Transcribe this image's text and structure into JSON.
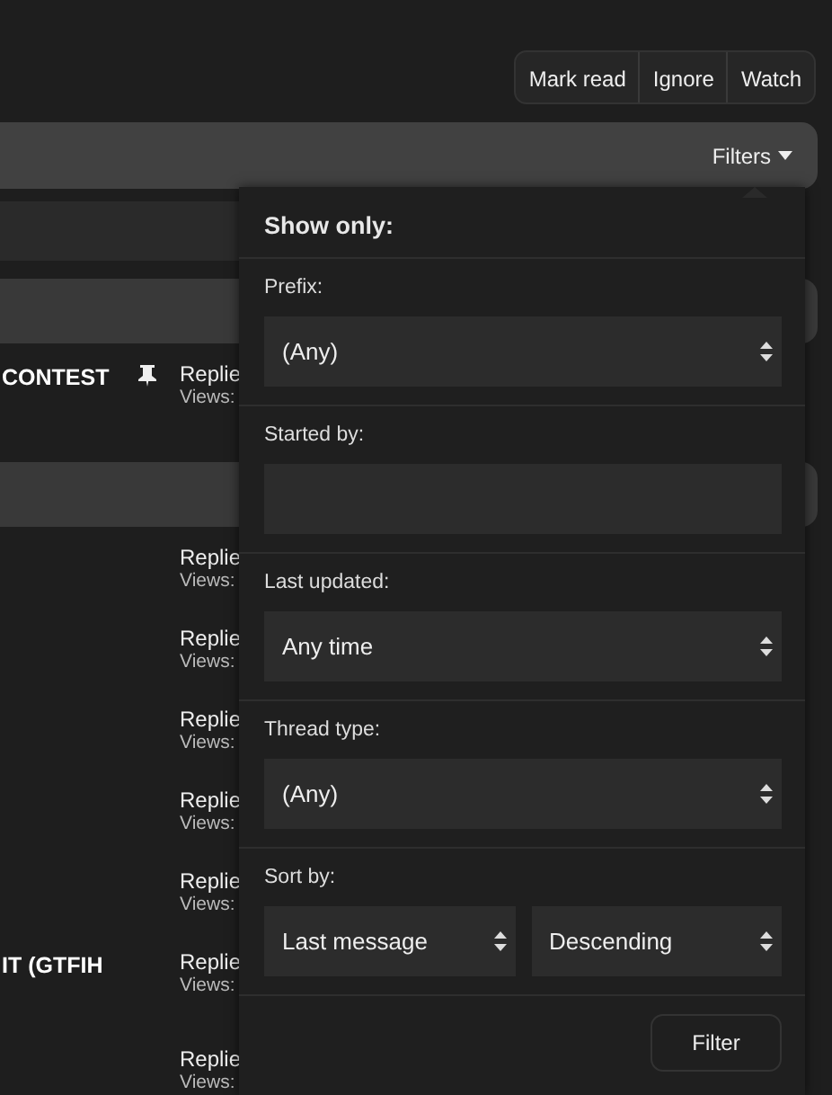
{
  "toolbar_buttons": [
    "Mark read",
    "Ignore",
    "Watch"
  ],
  "filter_bar": {
    "label": "Filters"
  },
  "threads": [
    {
      "kind": "band"
    },
    {
      "kind": "bar"
    },
    {
      "kind": "thread",
      "title": "CONTEST",
      "pinned": true,
      "replies": "Replie",
      "views": "Views:"
    },
    {
      "kind": "bar"
    },
    {
      "kind": "thread",
      "pinned": false,
      "replies": "Replie",
      "views": "Views:"
    },
    {
      "kind": "thread",
      "pinned": false,
      "replies": "Replie",
      "views": "Views:"
    },
    {
      "kind": "thread",
      "pinned": false,
      "replies": "Replie",
      "views": "Views:"
    },
    {
      "kind": "thread",
      "pinned": false,
      "replies": "Replie",
      "views": "Views:"
    },
    {
      "kind": "thread",
      "pinned": false,
      "replies": "Replie",
      "views": "Views:"
    },
    {
      "kind": "thread",
      "title": "IT (GTFIH",
      "pinned": false,
      "replies": "Replie",
      "views": "Views:"
    },
    {
      "kind": "thread",
      "pinned": false,
      "replies": "Replie",
      "views": "Views:"
    }
  ],
  "filter_popup": {
    "heading": "Show only:",
    "fields": [
      {
        "label": "Prefix:",
        "kind": "select",
        "values": [
          "(Any)"
        ]
      },
      {
        "label": "Started by:",
        "kind": "text"
      },
      {
        "label": "Last updated:",
        "kind": "select",
        "values": [
          "Any time"
        ]
      },
      {
        "label": "Thread type:",
        "kind": "select",
        "values": [
          "(Any)"
        ]
      },
      {
        "label": "Sort by:",
        "kind": "select",
        "values": [
          "Last message",
          "Descending"
        ]
      }
    ],
    "submit": "Filter"
  }
}
